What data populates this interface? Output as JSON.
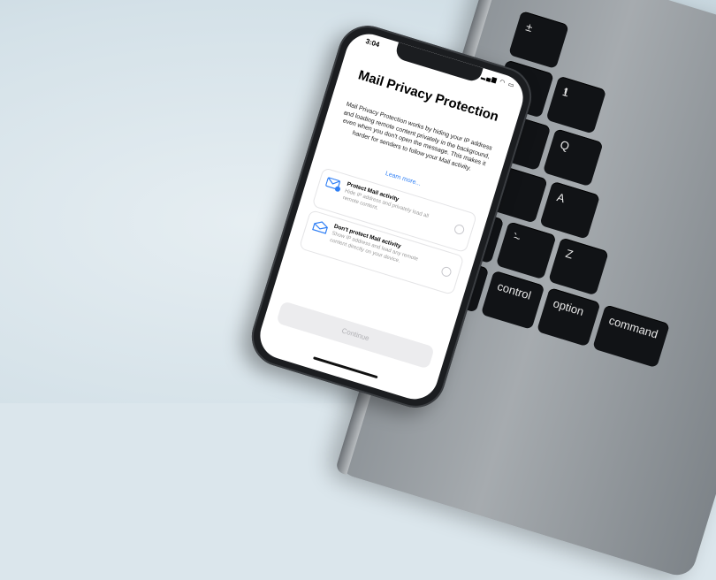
{
  "phone": {
    "status_time": "3:04",
    "status_icons": "▂▄▆ ◠ ▭",
    "title": "Mail Privacy Protection",
    "description": "Mail Privacy Protection works by hiding your IP address and loading remote content privately in the background, even when you don't open the message. This makes it harder for senders to follow your Mail activity.",
    "learn_more": "Learn more...",
    "options": [
      {
        "title": "Protect Mail activity",
        "subtitle": "Hide IP address and privately load all remote content."
      },
      {
        "title": "Don't protect Mail activity",
        "subtitle": "Show IP address and load any remote content directly on your device."
      }
    ],
    "continue_label": "Continue"
  },
  "laptop": {
    "keys": [
      "±",
      "§",
      "!",
      "1",
      "⇥",
      "Q",
      "⇪",
      "A",
      "fn",
      "control",
      "option",
      "command",
      "~",
      "`",
      "Z"
    ]
  },
  "colors": {
    "accent": "#2f7ff5",
    "background": "#dbe6ec"
  }
}
